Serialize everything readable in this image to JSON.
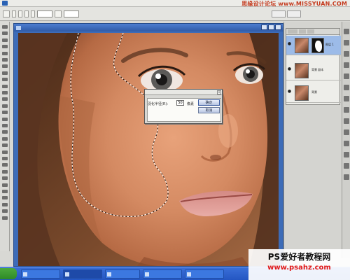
{
  "app": {
    "watermark_top": "思缘设计论坛 www.MISSYUAN.COM",
    "watermark_bottom_line1": "PS爱好者教程网",
    "watermark_bottom_line2": "www.psahz.com"
  },
  "dialog": {
    "label": "羽化半径(R):",
    "value": "50",
    "unit": "像素",
    "ok_label": "确定",
    "cancel_label": "取消",
    "close_label": "×"
  },
  "layers": [
    {
      "name": "图层 1",
      "selected": true
    },
    {
      "name": "背景 副本",
      "selected": false
    },
    {
      "name": "背景",
      "selected": false
    }
  ],
  "colors": {
    "titlebar_blue": "#2f5aa6",
    "watermark_red": "#c43a1e",
    "taskbar_blue": "#2456c2"
  },
  "icons": [
    "photoshop-icon",
    "close-icon",
    "eye-icon",
    "start-button-icon"
  ]
}
